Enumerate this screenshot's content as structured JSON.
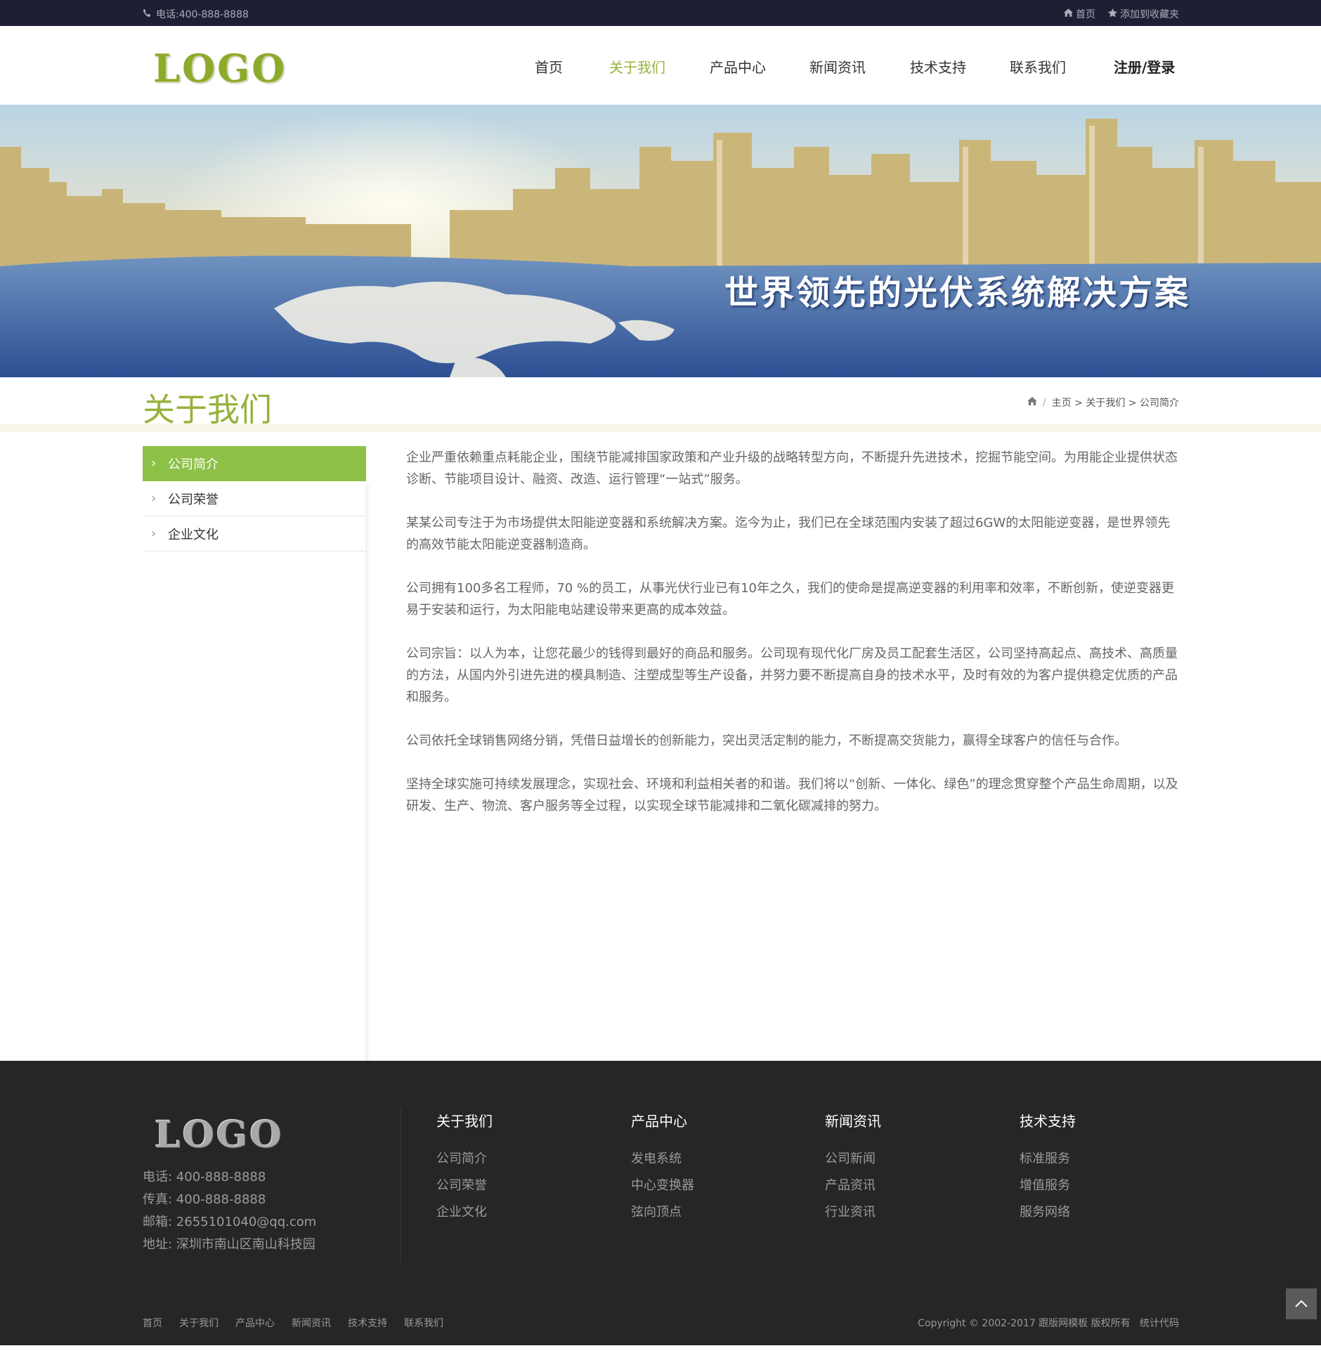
{
  "topbar": {
    "phone": "电话:400-888-8888",
    "home": "首页",
    "bookmark": "添加到收藏夹"
  },
  "header": {
    "logo": "LOGO",
    "nav": [
      {
        "label": "首页"
      },
      {
        "label": "关于我们"
      },
      {
        "label": "产品中心"
      },
      {
        "label": "新闻资讯"
      },
      {
        "label": "技术支持"
      },
      {
        "label": "联系我们"
      }
    ],
    "login": "注册/登录"
  },
  "banner": {
    "slogan": "世界领先的光伏系统解决方案"
  },
  "page": {
    "title": "关于我们",
    "breadcrumb": {
      "sep": "/",
      "path": "主页 > 关于我们 > 公司简介"
    }
  },
  "sidebar": {
    "items": [
      {
        "label": "公司简介",
        "active": true
      },
      {
        "label": "公司荣誉"
      },
      {
        "label": "企业文化"
      }
    ]
  },
  "content": {
    "paragraphs": [
      "企业严重依赖重点耗能企业，围绕节能减排国家政策和产业升级的战略转型方向，不断提升先进技术，挖掘节能空间。为用能企业提供状态诊断、节能项目设计、融资、改造、运行管理“一站式”服务。",
      "某某公司专注于为市场提供太阳能逆变器和系统解决方案。迄今为止，我们已在全球范围内安装了超过6GW的太阳能逆变器，是世界领先的高效节能太阳能逆变器制造商。",
      "公司拥有100多名工程师，70 %的员工，从事光伏行业已有10年之久，我们的使命是提高逆变器的利用率和效率，不断创新，使逆变器更易于安装和运行，为太阳能电站建设带来更高的成本效益。",
      "公司宗旨：以人为本，让您花最少的钱得到最好的商品和服务。公司现有现代化厂房及员工配套生活区，公司坚持高起点、高技术、高质量的方法，从国内外引进先进的模具制造、注塑成型等生产设备，并努力要不断提高自身的技术水平，及时有效的为客户提供稳定优质的产品和服务。",
      "公司依托全球销售网络分销，凭借日益增长的创新能力，突出灵活定制的能力，不断提高交货能力，赢得全球客户的信任与合作。",
      "坚持全球实施可持续发展理念，实现社会、环境和利益相关者的和谐。我们将以“创新、一体化、绿色”的理念贯穿整个产品生命周期，以及研发、生产、物流、客户服务等全过程，以实现全球节能减排和二氧化碳减排的努力。"
    ]
  },
  "footer": {
    "logo": "LOGO",
    "contact": {
      "phone": "电话: 400-888-8888",
      "fax": "传真: 400-888-8888",
      "email": "邮箱: 2655101040@qq.com",
      "address": "地址: 深圳市南山区南山科技园"
    },
    "columns": [
      {
        "title": "关于我们",
        "links": [
          "公司简介",
          "公司荣誉",
          "企业文化"
        ]
      },
      {
        "title": "产品中心",
        "links": [
          "发电系统",
          "中心变换器",
          "弦向顶点"
        ]
      },
      {
        "title": "新闻资讯",
        "links": [
          "公司新闻",
          "产品资讯",
          "行业资讯"
        ]
      },
      {
        "title": "技术支持",
        "links": [
          "标准服务",
          "增值服务",
          "服务网络"
        ]
      }
    ],
    "bottom_links": [
      "首页",
      "关于我们",
      "产品中心",
      "新闻资讯",
      "技术支持",
      "联系我们"
    ],
    "copyright": "Copyright © 2002-2017 跟版网模板 版权所有",
    "stats": "统计代码"
  },
  "colors": {
    "topbar_bg": "#1d2035",
    "accent_green": "#96b23c",
    "sidebar_active": "#8dc148",
    "footer_bg": "#262626"
  }
}
